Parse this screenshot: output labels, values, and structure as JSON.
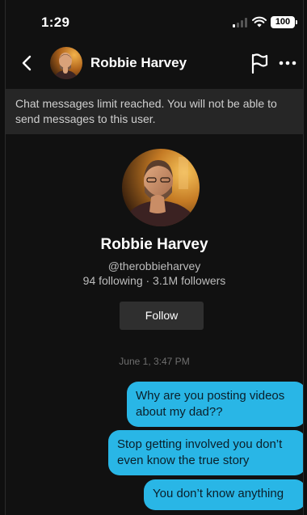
{
  "status_bar": {
    "time": "1:29",
    "battery": "100"
  },
  "header": {
    "contact_name": "Robbie Harvey"
  },
  "banner": {
    "message": "Chat messages limit reached. You will not be able to send messages to this user."
  },
  "profile": {
    "name": "Robbie Harvey",
    "handle": "@therobbieharvey",
    "stats": "94 following · 3.1M followers",
    "follow_label": "Follow"
  },
  "conversation": {
    "timestamp": "June 1, 3:47 PM",
    "messages": [
      {
        "text": "Why are you posting videos about my dad??"
      },
      {
        "text": "Stop getting involved you don’t even know the true story"
      },
      {
        "text": "You don’t know anything"
      }
    ]
  },
  "colors": {
    "background": "#111111",
    "banner": "#262626",
    "bubble": "#29b6e6",
    "button": "#2f2f2f"
  }
}
